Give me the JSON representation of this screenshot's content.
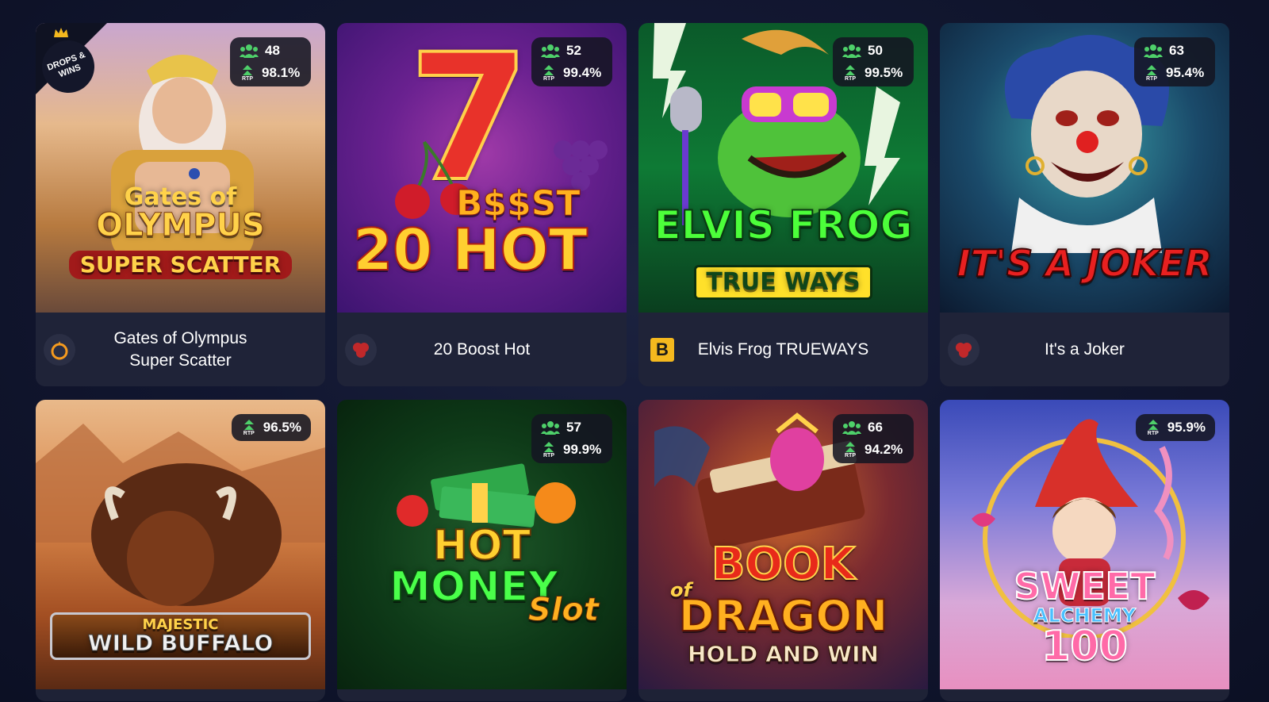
{
  "games": [
    {
      "title": "Gates of Olympus Super Scatter",
      "art_lines": [
        "Gates of",
        "OLYMPUS",
        "SUPER SCATTER"
      ],
      "players": "48",
      "rtp_label": "RTP",
      "rtp": "98.1%",
      "badge": "DROPS & WINS",
      "provider_icon": "pragmatic-play-icon"
    },
    {
      "title": "20 Boost Hot",
      "art_lines": [
        "7",
        "B$$ST",
        "20 HOT"
      ],
      "players": "52",
      "rtp_label": "RTP",
      "rtp": "99.4%",
      "provider_icon": "spade-provider-icon"
    },
    {
      "title": "Elvis Frog TRUEWAYS",
      "art_lines": [
        "ELVIS FROG",
        "TRUE WAYS"
      ],
      "players": "50",
      "rtp_label": "RTP",
      "rtp": "99.5%",
      "provider_icon": "bgaming-b-icon",
      "provider_letter": "B"
    },
    {
      "title": "It's a Joker",
      "art_lines": [
        "IT'S A JOKER"
      ],
      "players": "63",
      "rtp_label": "RTP",
      "rtp": "95.4%",
      "provider_icon": "spade-provider-icon"
    },
    {
      "title": "Majestic Wild Buffalo",
      "art_lines": [
        "MAJESTIC",
        "WILD BUFFALO"
      ],
      "rtp_label": "RTP",
      "rtp": "96.5%"
    },
    {
      "title": "Hot Money Slot",
      "art_lines": [
        "HOT",
        "MONEY",
        "Slot"
      ],
      "players": "57",
      "rtp_label": "RTP",
      "rtp": "99.9%"
    },
    {
      "title": "Book of Dragon Hold and Win",
      "art_lines": [
        "BOOK",
        "of",
        "DRAGON",
        "HOLD AND WIN"
      ],
      "players": "66",
      "rtp_label": "RTP",
      "rtp": "94.2%"
    },
    {
      "title": "Sweet Alchemy 100",
      "art_lines": [
        "SWEET",
        "ALCHEMY",
        "100"
      ],
      "rtp_label": "RTP",
      "rtp": "95.9%"
    }
  ],
  "colors": {
    "accent_green": "#4ed06a",
    "card_bg": "#1f2338",
    "page_bg": "#121731"
  }
}
